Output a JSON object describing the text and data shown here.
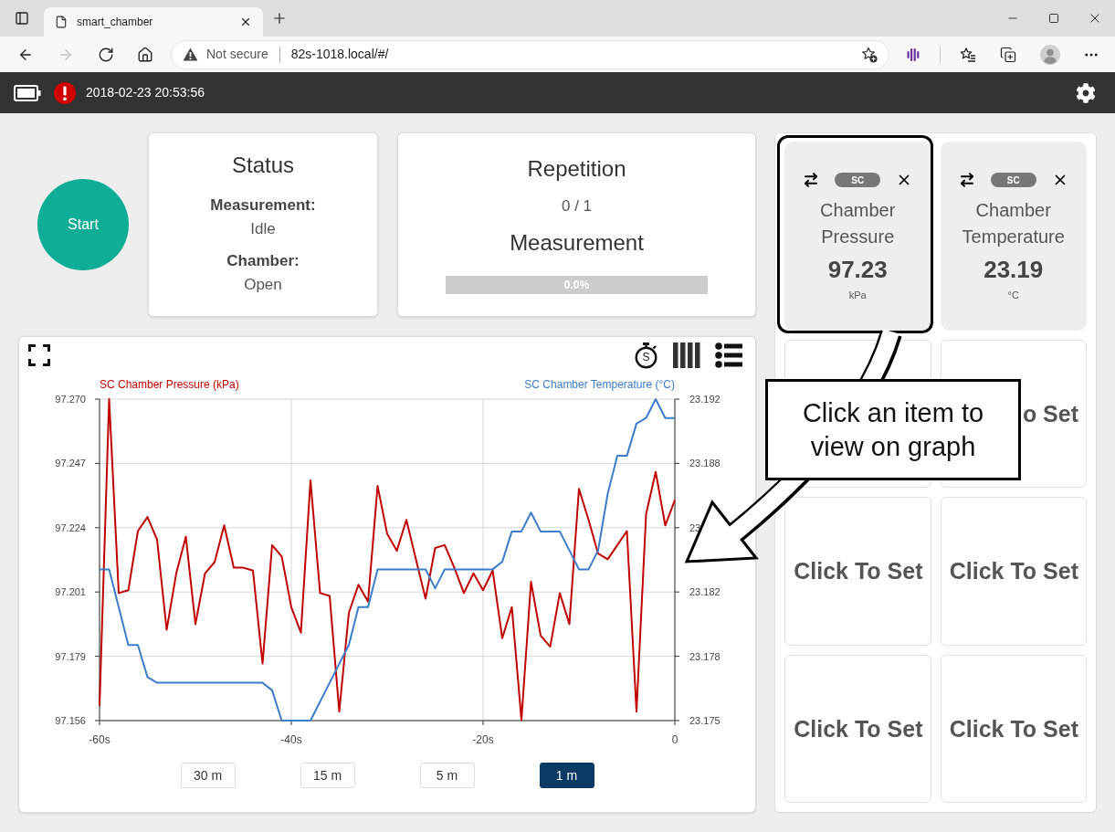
{
  "browser": {
    "tab": {
      "title": "smart_chamber"
    },
    "forward": {
      "disabled": true
    },
    "address": {
      "security": "Not secure",
      "url": "82s-1018.local/#/"
    }
  },
  "app_bar": {
    "timestamp": "2018-02-23 20:53:56"
  },
  "start_button": {
    "label": "Start"
  },
  "status_card": {
    "title": "Status",
    "fields": [
      {
        "label": "Measurement:",
        "value": "Idle"
      },
      {
        "label": "Chamber:",
        "value": "Open"
      }
    ]
  },
  "repetition_card": {
    "title": "Repetition",
    "count": "0 / 1",
    "subtitle": "Measurement",
    "progress": {
      "level": 0,
      "label": "0.0%"
    }
  },
  "chart_panel": {
    "timer_label": "S",
    "chart_data": {
      "type": "line",
      "grid": true,
      "x": [
        -60,
        -59,
        -58,
        -57,
        -56,
        -55,
        -54,
        -53,
        -52,
        -51,
        -50,
        -49,
        -48,
        -47,
        -46,
        -45,
        -44,
        -43,
        -42,
        -41,
        -40,
        -39,
        -38,
        -37,
        -36,
        -35,
        -34,
        -33,
        -32,
        -31,
        -30,
        -29,
        -28,
        -27,
        -26,
        -25,
        -24,
        -23,
        -22,
        -21,
        -20,
        -19,
        -18,
        -17,
        -16,
        -15,
        -14,
        -13,
        -12,
        -11,
        -10,
        -9,
        -8,
        -7,
        -6,
        -5,
        -4,
        -3,
        -2,
        -1,
        0
      ],
      "series": [
        {
          "name": "SC Chamber Pressure (kPa)",
          "color": "#c00000",
          "values": [
            97.161,
            97.2698,
            97.201,
            97.202,
            97.223,
            97.228,
            97.22,
            97.188,
            97.208,
            97.221,
            97.19,
            97.208,
            97.212,
            97.225,
            97.21,
            97.21,
            97.209,
            97.176,
            97.218,
            97.214,
            97.196,
            97.187,
            97.241,
            97.201,
            97.2,
            97.159,
            97.194,
            97.204,
            97.198,
            97.239,
            97.222,
            97.216,
            97.227,
            97.213,
            97.199,
            97.217,
            97.218,
            97.21,
            97.201,
            97.208,
            97.202,
            97.209,
            97.185,
            97.196,
            97.156,
            97.205,
            97.186,
            97.182,
            97.201,
            97.19,
            97.238,
            97.227,
            97.215,
            97.213,
            97.218,
            97.223,
            97.159,
            97.229,
            97.244,
            97.225,
            97.234
          ]
        },
        {
          "name": "SC Chamber Temperature (°C)",
          "color": "#3b7dc8",
          "axis": "y2",
          "values": [
            23.1828,
            23.1828,
            23.1808,
            23.1788,
            23.1788,
            23.1771,
            23.1768,
            23.1768,
            23.1768,
            23.1768,
            23.1768,
            23.1768,
            23.1768,
            23.1768,
            23.1768,
            23.1768,
            23.1768,
            23.1768,
            23.1764,
            23.1748,
            23.1748,
            23.1748,
            23.1748,
            23.1758,
            23.1768,
            23.1778,
            23.1788,
            23.1808,
            23.1808,
            23.1828,
            23.1828,
            23.1828,
            23.1828,
            23.1828,
            23.1828,
            23.1818,
            23.1828,
            23.1828,
            23.1828,
            23.1828,
            23.1828,
            23.1828,
            23.1832,
            23.1848,
            23.1848,
            23.1858,
            23.1848,
            23.1848,
            23.1848,
            23.1838,
            23.1828,
            23.1828,
            23.1838,
            23.1868,
            23.1888,
            23.1888,
            23.1905,
            23.1908,
            23.1918,
            23.1908,
            23.1908
          ]
        }
      ],
      "xlim": [
        -60,
        0
      ],
      "ylim": [
        97.1558,
        97.2698
      ],
      "y2lim": [
        23.1748,
        23.1918
      ],
      "xticks": [
        {
          "value": -60,
          "label": "-60s"
        },
        {
          "value": -40,
          "label": "-40s"
        },
        {
          "value": -20,
          "label": "-20s"
        },
        {
          "value": 0,
          "label": "0"
        }
      ],
      "yticks": [
        {
          "value": 97.1558,
          "label": "97.156"
        },
        {
          "value": 97.1786,
          "label": "97.179"
        },
        {
          "value": 97.2014,
          "label": "97.201"
        },
        {
          "value": 97.2242,
          "label": "97.224"
        },
        {
          "value": 97.247,
          "label": "97.247"
        },
        {
          "value": 97.2698,
          "label": "97.270"
        }
      ],
      "y2ticks": [
        {
          "value": 23.1748,
          "label": "23.175"
        },
        {
          "value": 23.1782,
          "label": "23.178"
        },
        {
          "value": 23.1816,
          "label": "23.182"
        },
        {
          "value": 23.185,
          "label": "23"
        },
        {
          "value": 23.1884,
          "label": "23.188"
        },
        {
          "value": 23.1918,
          "label": "23.192"
        }
      ]
    },
    "ranges": [
      {
        "label": "30 m",
        "selected": false
      },
      {
        "label": "15 m",
        "selected": false
      },
      {
        "label": "5 m",
        "selected": false
      },
      {
        "label": "1 m",
        "selected": true
      }
    ]
  },
  "tiles": [
    {
      "kind": "metric",
      "tag": "SC",
      "name": "Chamber Pressure",
      "value": "97.23",
      "unit": "kPa"
    },
    {
      "kind": "metric",
      "tag": "SC",
      "name": "Chamber Temperature",
      "value": "23.19",
      "unit": "°C"
    },
    {
      "kind": "empty"
    },
    {
      "kind": "empty",
      "label": "o Set"
    },
    {
      "kind": "empty",
      "label": "Click To Set"
    },
    {
      "kind": "empty",
      "label": "Click To Set"
    },
    {
      "kind": "empty",
      "label": "Click To Set"
    },
    {
      "kind": "empty",
      "label": "Click To Set"
    }
  ],
  "callout": {
    "text": "Click an item to view on graph"
  }
}
